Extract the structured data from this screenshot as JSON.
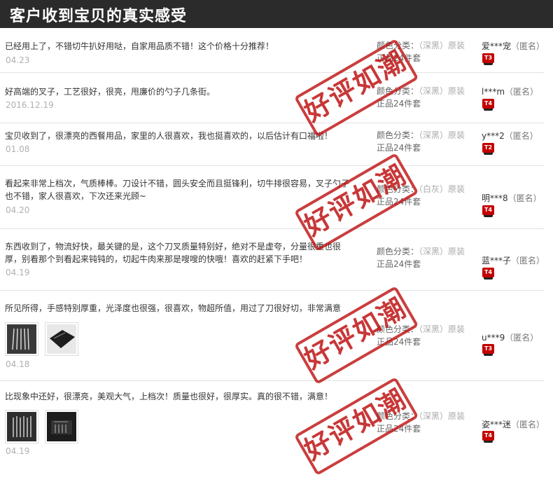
{
  "header": {
    "title": "客户收到宝贝的真实感受"
  },
  "stamp_text": "好评如潮",
  "reviews": [
    {
      "comment": "已经用上了，不错切牛扒好用哒，自家用品质不错！这个价格十分推荐！",
      "date": "04.23",
      "sku_label": "颜色分类：",
      "sku_color": "（深黑）原装",
      "sku_set": "正品24件套",
      "user": "爱***宠",
      "anon": "（匿名）",
      "level": "T3"
    },
    {
      "comment": "好高端的叉子，工艺很好，很亮，甩廉价的勺子几条街。",
      "date": "2016.12.19",
      "sku_label": "颜色分类：",
      "sku_color": "（深黑）原装",
      "sku_set": "正品24件套",
      "user": "l***m",
      "anon": "（匿名）",
      "level": "T4"
    },
    {
      "comment": "宝贝收到了，很漂亮的西餐用品，家里的人很喜欢，我也挺喜欢的，以后估计有口福啦！",
      "date": "01.08",
      "sku_label": "颜色分类：",
      "sku_color": "（深黑）原装",
      "sku_set": "正品24件套",
      "user": "y***2",
      "anon": "（匿名）",
      "level": "T2"
    },
    {
      "comment": "看起来非常上档次，气质棒棒。刀设计不错，圆头安全而且挺锋利，切牛排很容易，叉子勺子也不错，家人很喜欢，下次还来光顾~",
      "date": "04.20",
      "sku_label": "颜色分类：",
      "sku_color": "（白灰）原装",
      "sku_set": "正品24件套",
      "user": "明***8",
      "anon": "（匿名）",
      "level": "T4"
    },
    {
      "comment": "东西收到了，物流好快，最关键的是，这个刀叉质量特别好，绝对不是虚夸，分量很重也很厚，别看那个到看起来钝钝的，切起牛肉来那是嗖嗖的快哦！喜欢的赶紧下手吧！",
      "date": "04.19",
      "sku_label": "颜色分类：",
      "sku_color": "（深黑）原装",
      "sku_set": "正品24件套",
      "user": "蓝***子",
      "anon": "（匿名）",
      "level": "T4"
    },
    {
      "comment": "所见所得，手感特别厚重，光泽度也很强，很喜欢，物超所值，用过了刀很好切，非常满意",
      "date": "04.18",
      "sku_label": "颜色分类：",
      "sku_color": "（深黑）原装",
      "sku_set": "正品24件套",
      "user": "u***9",
      "anon": "（匿名）",
      "level": "T3"
    },
    {
      "comment": "比现象中还好，很漂亮，美观大气，上档次！质量也很好，很厚实。真的很不错，满意！",
      "date": "04.19",
      "sku_label": "颜色分类：",
      "sku_color": "（深黑）原装",
      "sku_set": "正品24件套",
      "user": "姿***迷",
      "anon": "（匿名）",
      "level": "T4"
    }
  ]
}
